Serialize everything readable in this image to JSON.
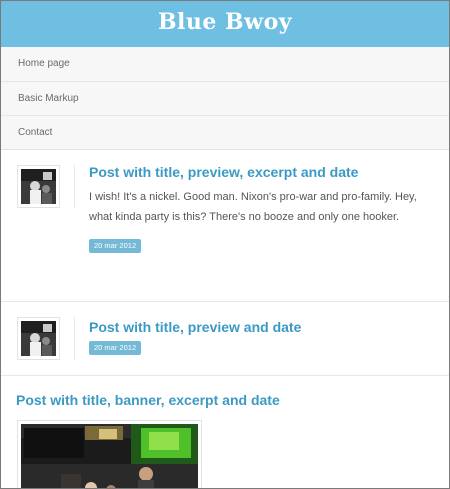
{
  "site": {
    "title": "Blue Bwoy"
  },
  "nav": {
    "items": [
      {
        "label": "Home page"
      },
      {
        "label": "Basic Markup"
      },
      {
        "label": "Contact"
      }
    ]
  },
  "posts": [
    {
      "title": "Post with title, preview, excerpt and date",
      "excerpt": "I wish! It's a nickel. Good man. Nixon's pro-war and pro-family. Hey, what kinda party is this? There's no booze and only one hooker.",
      "date": "20 mar 2012"
    },
    {
      "title": "Post with title, preview and date",
      "date": "20 mar 2012"
    },
    {
      "title": "Post with title, banner, excerpt and date"
    }
  ],
  "colors": {
    "header": "#6fbfe3",
    "title_link": "#3b9ac4",
    "badge": "#74b9d6"
  },
  "icons": {
    "thumbnail": "party-photo-thumbnail",
    "banner": "party-photo-banner"
  }
}
